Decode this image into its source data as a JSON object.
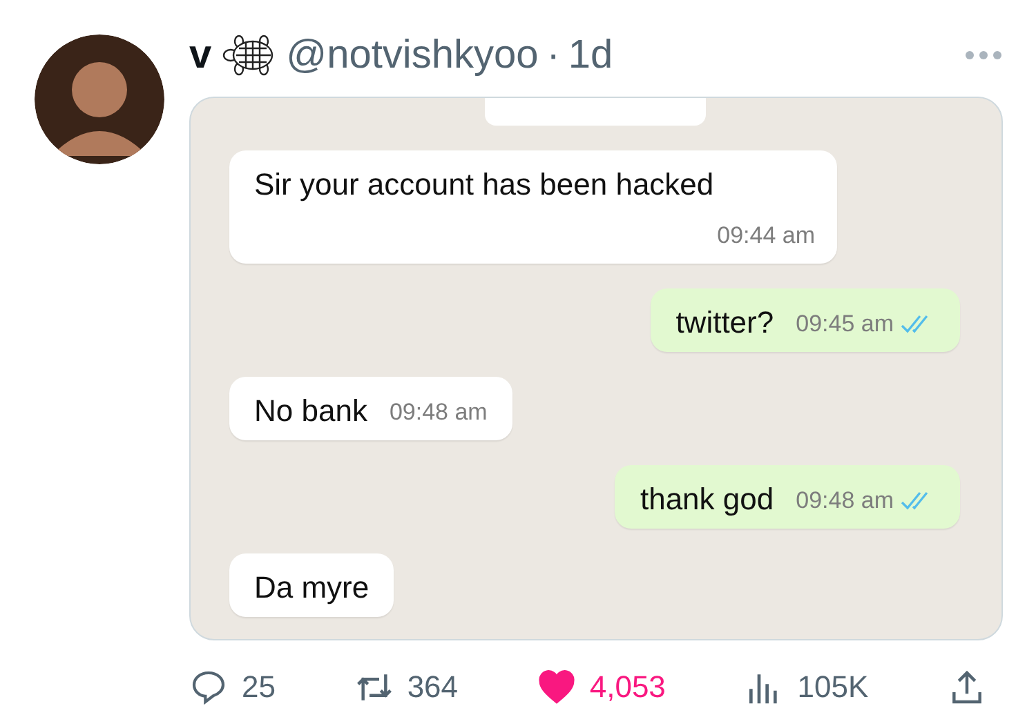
{
  "author": {
    "name": "v",
    "handle": "@notvishkyoo",
    "separator": "·",
    "time": "1d"
  },
  "chat": {
    "messages": [
      {
        "kind": "incoming",
        "text": "Sir your account has been hacked",
        "time": "09:44 am"
      },
      {
        "kind": "outgoing",
        "text": "twitter?",
        "time": "09:45 am",
        "read": true
      },
      {
        "kind": "incoming",
        "text": "No bank",
        "time": "09:48 am"
      },
      {
        "kind": "outgoing",
        "text": "thank god",
        "time": "09:48 am",
        "read": true
      },
      {
        "kind": "incoming",
        "text": "Da myre"
      }
    ]
  },
  "actions": {
    "replies": "25",
    "reposts": "364",
    "likes": "4,053",
    "liked": true,
    "views": "105K"
  }
}
